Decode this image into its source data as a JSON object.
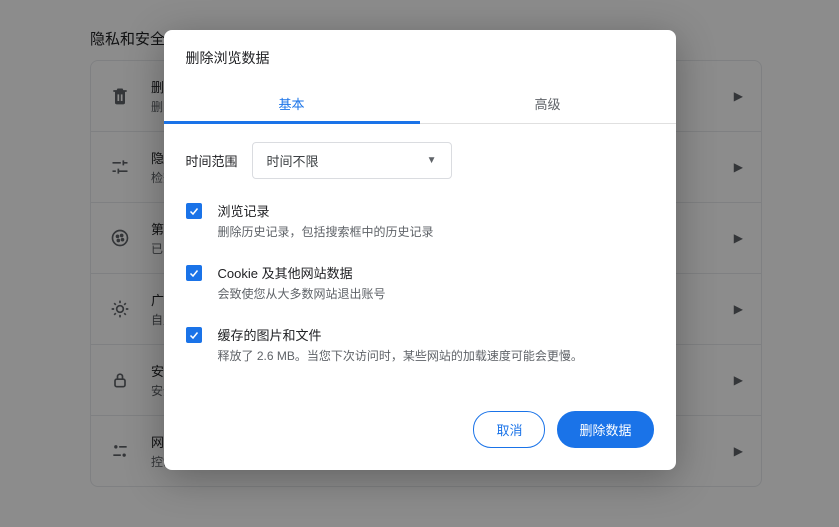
{
  "page": {
    "title": "隐私和安全",
    "rows": [
      {
        "title": "删除",
        "sub": "删除"
      },
      {
        "title": "隐私",
        "sub": "检查"
      },
      {
        "title": "第三",
        "sub": "已阻"
      },
      {
        "title": "广告",
        "sub": "自定"
      },
      {
        "title": "安全",
        "sub": "安全"
      },
      {
        "title": "网站",
        "sub": "控制"
      }
    ]
  },
  "dialog": {
    "title": "删除浏览数据",
    "tabs": {
      "basic": "基本",
      "advanced": "高级"
    },
    "range_label": "时间范围",
    "range_value": "时间不限",
    "items": [
      {
        "title": "浏览记录",
        "desc": "删除历史记录，包括搜索框中的历史记录",
        "checked": true
      },
      {
        "title": "Cookie 及其他网站数据",
        "desc": "会致使您从大多数网站退出账号",
        "checked": true
      },
      {
        "title": "缓存的图片和文件",
        "desc": "释放了 2.6 MB。当您下次访问时，某些网站的加载速度可能会更慢。",
        "checked": true
      }
    ],
    "cancel": "取消",
    "confirm": "删除数据"
  }
}
